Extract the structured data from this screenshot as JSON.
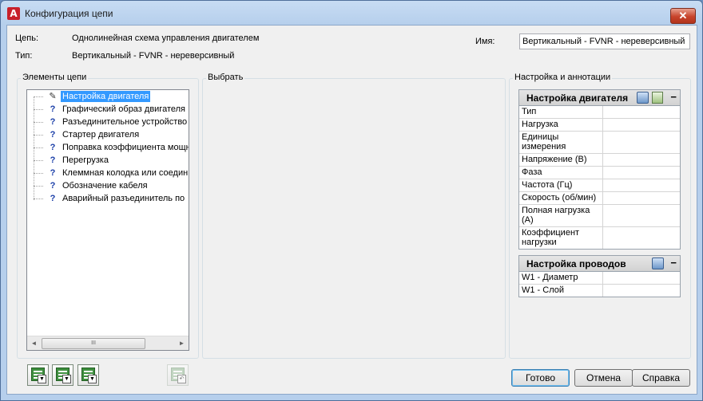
{
  "window": {
    "title": "Конфигурация цепи",
    "app_icon_letter": "A"
  },
  "header": {
    "circuit_label": "Цепь:",
    "circuit_value": "Однолинейная схема управления двигателем",
    "type_label": "Тип:",
    "type_value": "Вертикальный - FVNR - нереверсивный",
    "name_label": "Имя:",
    "name_value": "Вертикальный - FVNR - нереверсивный (l"
  },
  "elements_group": {
    "title": "Элементы цепи",
    "items": [
      {
        "label": "Настройка двигателя",
        "icon": "pencil-icon",
        "selected": true
      },
      {
        "label": "Графический образ двигателя",
        "icon": "question-icon"
      },
      {
        "label": "Разъединительное устройство",
        "icon": "question-icon"
      },
      {
        "label": "Стартер двигателя",
        "icon": "question-icon"
      },
      {
        "label": "Поправка коэффициента мощн",
        "icon": "question-icon"
      },
      {
        "label": "Перегрузка",
        "icon": "question-icon"
      },
      {
        "label": "Клеммная колодка или соедин",
        "icon": "question-icon"
      },
      {
        "label": "Обозначение кабеля",
        "icon": "question-icon"
      },
      {
        "label": "Аварийный разъединитель по",
        "icon": "question-icon"
      }
    ],
    "scroll_left": "◄",
    "scroll_right": "►",
    "scroll_grip": "III"
  },
  "select_group": {
    "title": "Выбрать"
  },
  "settings_group": {
    "title": "Настройка и аннотации",
    "motor_panel": {
      "title": "Настройка двигателя",
      "collapse": "−",
      "rows": [
        "Тип",
        "Нагрузка",
        "Единицы измерения",
        "Напряжение (В)",
        "Фаза",
        "Частота (Гц)",
        "Скорость (об/мин)",
        "Полная нагрузка (A)",
        "Коэффициент нагрузки"
      ]
    },
    "wire_panel": {
      "title": "Настройка проводов",
      "collapse": "−",
      "rows": [
        "W1 - Диаметр",
        "W1 - Слой"
      ]
    }
  },
  "buttons": {
    "ok": "Готово",
    "cancel": "Отмена",
    "help": "Справка"
  },
  "colors": {
    "selection": "#3399ff",
    "close_button": "#c7432b",
    "window_frame": "#b6cfec"
  }
}
